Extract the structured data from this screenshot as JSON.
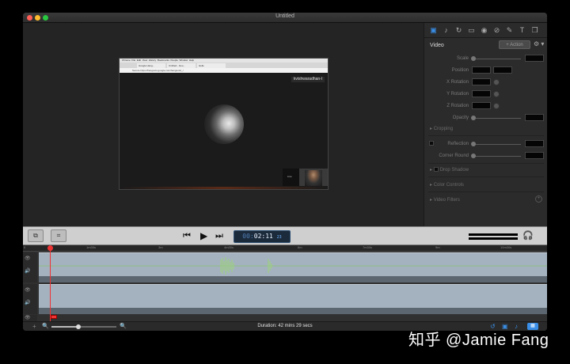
{
  "window": {
    "title": "Untitled",
    "traffic_lights": {
      "close": "#ff5f57",
      "minimize": "#febc2e",
      "zoom": "#28c840"
    }
  },
  "recording": {
    "browser_menu": [
      " Chrome",
      "File",
      "Edit",
      "View",
      "History",
      "Bookmarks",
      "People",
      "Window",
      "Help"
    ],
    "browser_tabs": [
      "Google Hang...",
      "Untitled - Goo...",
      "Hello"
    ],
    "url": "Secure  https://hangouts.google.com/hangouts/_/",
    "participant_name": "kvishwaradhan-l",
    "self_view_label": "Live"
  },
  "inspector": {
    "tabs": [
      "video-icon",
      "audio-icon",
      "callout-icon",
      "screen-icon",
      "cursor-icon",
      "filter-icon",
      "annotation-icon",
      "text-icon",
      "copy-icon"
    ],
    "header": "Video",
    "action_label": "+ Action",
    "gear": "⚙ ▾",
    "properties": [
      {
        "label": "Scale"
      },
      {
        "label": "Position"
      },
      {
        "label": "X Rotation"
      },
      {
        "label": "Y Rotation"
      },
      {
        "label": "Z Rotation"
      },
      {
        "label": "Opacity"
      }
    ],
    "cropping": "Cropping",
    "reflection": "Reflection",
    "corner_round": "Corner Round",
    "drop_shadow": "Drop Shadow",
    "color_controls": "Color Controls",
    "video_filters": "Video Filters"
  },
  "toolbar": {
    "rewind": "⏮",
    "play": "▶",
    "fast_forward": "⏭",
    "timecode_hours": "00:",
    "timecode_main": "02:11",
    "timecode_frames": "23"
  },
  "timeline": {
    "ruler_labels": [
      "0",
      "1m30s",
      "3m",
      "4m30s",
      "6m",
      "7m30s",
      "9m",
      "10m30s"
    ],
    "duration": "Duration: 42 mins 29 secs",
    "playhead_fraction": 0.051,
    "zoom_fraction": 0.42
  },
  "watermark": "知乎 @Jamie Fang"
}
